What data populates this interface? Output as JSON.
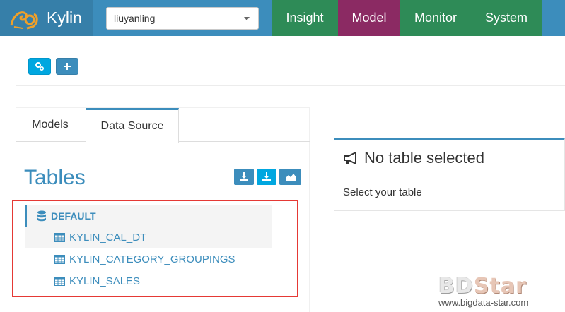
{
  "navbar": {
    "brand": "Kylin",
    "project": "liuyanling",
    "tabs": [
      "Insight",
      "Model",
      "Monitor",
      "System"
    ]
  },
  "tabs": {
    "models": "Models",
    "data_source": "Data Source"
  },
  "tables": {
    "title": "Tables",
    "database": "DEFAULT",
    "items": [
      "KYLIN_CAL_DT",
      "KYLIN_CATEGORY_GROUPINGS",
      "KYLIN_SALES"
    ]
  },
  "detail": {
    "title": "No table selected",
    "hint": "Select your table"
  },
  "watermark": {
    "logo_a": "BD",
    "logo_b": "Star",
    "url": "www.bigdata-star.com"
  },
  "colors": {
    "primary": "#3c8dbc",
    "active_nav": "#8b2a63",
    "nav_green": "#2e8b57",
    "highlight": "#e53935"
  }
}
